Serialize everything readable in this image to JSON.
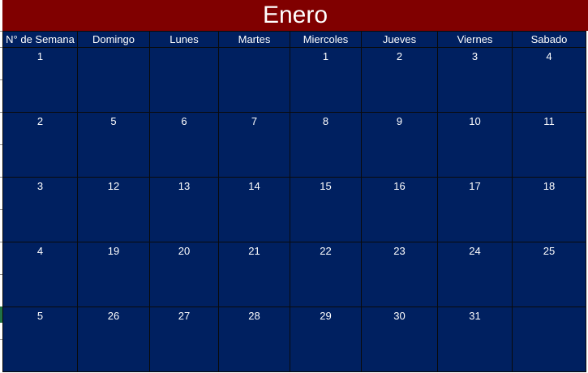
{
  "calendar": {
    "month_title": "Enero",
    "headers": [
      "N° de Semana",
      "Domingo",
      "Lunes",
      "Martes",
      "Miercoles",
      "Jueves",
      "Viernes",
      "Sabado"
    ],
    "weeks": [
      [
        "1",
        "",
        "",
        "",
        "1",
        "2",
        "3",
        "4"
      ],
      [
        "2",
        "5",
        "6",
        "7",
        "8",
        "9",
        "10",
        "11"
      ],
      [
        "3",
        "12",
        "13",
        "14",
        "15",
        "16",
        "17",
        "18"
      ],
      [
        "4",
        "19",
        "20",
        "21",
        "22",
        "23",
        "24",
        "25"
      ],
      [
        "5",
        "26",
        "27",
        "28",
        "29",
        "30",
        "31",
        ""
      ]
    ]
  },
  "colors": {
    "title_background": "#800000",
    "grid_background": "#002060",
    "text": "#ffffff",
    "selected_row_marker": "#217346"
  }
}
